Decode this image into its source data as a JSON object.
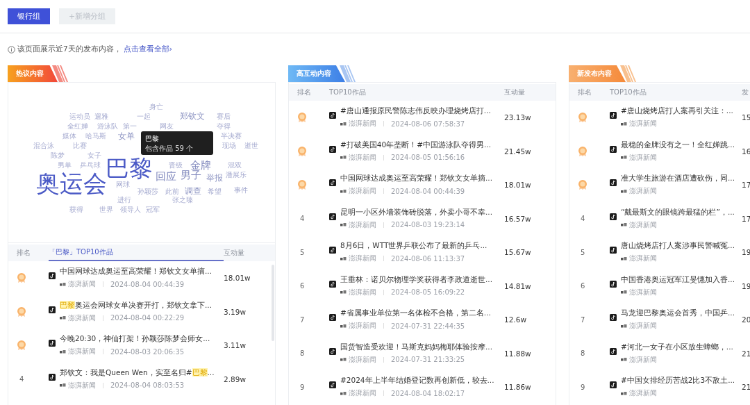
{
  "groups": [
    {
      "label": "银行组",
      "selected": true
    },
    {
      "label": "+新增分组",
      "selected": false
    }
  ],
  "notice": {
    "text": "该页面展示近7天的发布内容，",
    "link": "点击查看全部›"
  },
  "panels": [
    {
      "kind": "hot",
      "title": "热议内容",
      "word_cloud": {
        "words": [
          {
            "text": "身亡",
            "kind": "s"
          },
          {
            "text": "运动员",
            "kind": "s"
          },
          {
            "text": "遛雅",
            "kind": "s"
          },
          {
            "text": "一起",
            "kind": "s"
          },
          {
            "text": "郑钦文",
            "kind": "m"
          },
          {
            "text": "赛后",
            "kind": "s"
          },
          {
            "text": "全红婵",
            "kind": "s"
          },
          {
            "text": "游泳队",
            "kind": "s"
          },
          {
            "text": "第一",
            "kind": "s"
          },
          {
            "text": "网友",
            "kind": "s"
          },
          {
            "text": "夺得",
            "kind": "s"
          },
          {
            "text": "媒体",
            "kind": "s"
          },
          {
            "text": "哈马斯",
            "kind": "s"
          },
          {
            "text": "女单",
            "kind": "m"
          },
          {
            "text": "半决赛",
            "kind": "s"
          },
          {
            "text": "混合泳",
            "kind": "s"
          },
          {
            "text": "比赛",
            "kind": "s"
          },
          {
            "text": "现场",
            "kind": "s"
          },
          {
            "text": "逝世",
            "kind": "s"
          },
          {
            "text": "陈梦",
            "kind": "s"
          },
          {
            "text": "女子",
            "kind": "s"
          },
          {
            "text": "男单",
            "kind": "s"
          },
          {
            "text": "乒乓球",
            "kind": "s"
          },
          {
            "text": "巴黎",
            "kind": "xl"
          },
          {
            "text": "晋级",
            "kind": "s"
          },
          {
            "text": "金牌",
            "kind": "l"
          },
          {
            "text": "混双",
            "kind": "s"
          },
          {
            "text": "奥运会",
            "kind": "xl"
          },
          {
            "text": "网球",
            "kind": "s"
          },
          {
            "text": "回应",
            "kind": "l"
          },
          {
            "text": "男子",
            "kind": "l"
          },
          {
            "text": "举报",
            "kind": "m"
          },
          {
            "text": "潘展乐",
            "kind": "s"
          },
          {
            "text": "孙颖莎",
            "kind": "s"
          },
          {
            "text": "此前",
            "kind": "s"
          },
          {
            "text": "调查",
            "kind": "m"
          },
          {
            "text": "希望",
            "kind": "s"
          },
          {
            "text": "事件",
            "kind": "s"
          },
          {
            "text": "进行",
            "kind": "s"
          },
          {
            "text": "张之臻",
            "kind": "s"
          },
          {
            "text": "获得",
            "kind": "s"
          },
          {
            "text": "世界",
            "kind": "s"
          },
          {
            "text": "领导人",
            "kind": "s"
          },
          {
            "text": "冠军",
            "kind": "s"
          }
        ],
        "tooltip": {
          "title": "巴黎",
          "text": "包含作品 59 个"
        }
      },
      "columns": [
        "排名",
        "「巴黎」TOP10作品",
        "互动量"
      ],
      "works_tab_selected": true,
      "rows": [
        {
          "kind": "medal",
          "title": [
            {
              "text": "中国网球达成奥运至高荣耀！郑钦文女单摘...",
              "highlight": false
            }
          ],
          "source": "澎湃新闻",
          "time": "2024-08-04 00:44:39",
          "metric": "18.01w"
        },
        {
          "kind": "medal",
          "title": [
            {
              "text": "巴黎",
              "highlight": true
            },
            {
              "text": "奥运会网球女单决赛开打，郑钦文拿下...",
              "highlight": false
            }
          ],
          "source": "澎湃新闻",
          "time": "2024-08-04 00:22:29",
          "metric": "3.19w"
        },
        {
          "kind": "medal",
          "title": [
            {
              "text": "今晚20:30，神仙打架！孙颖莎陈梦会师女...",
              "highlight": false
            }
          ],
          "source": "澎湃新闻",
          "time": "2024-08-03 20:06:35",
          "metric": "3.11w"
        },
        {
          "kind": "number",
          "rank": "4",
          "title": [
            {
              "text": "郑钦文：我是Queen Wen，实至名归#",
              "highlight": false
            },
            {
              "text": "巴黎",
              "highlight": true
            },
            {
              "text": "...",
              "highlight": false
            }
          ],
          "source": "澎湃新闻",
          "time": "2024-08-04 08:03:53",
          "metric": "2.89w"
        }
      ]
    },
    {
      "kind": "interactive",
      "title": "高互动内容",
      "columns": [
        "排名",
        "TOP10作品",
        "互动量"
      ],
      "rows": [
        {
          "kind": "medal",
          "title": "#唐山通报原民警陈志伟反映办理烧烤店打...",
          "source": "澎湃新闻",
          "time": "2024-08-06 07:58:37",
          "metric": "23.13w"
        },
        {
          "kind": "medal",
          "title": "#打破美国40年垄断！#中国游泳队夺得男...",
          "source": "澎湃新闻",
          "time": "2024-08-05 01:56:16",
          "metric": "21.45w"
        },
        {
          "kind": "medal",
          "title": "中国网球达成奥运至高荣耀！郑钦文女单摘...",
          "source": "澎湃新闻",
          "time": "2024-08-04 00:44:39",
          "metric": "18.01w"
        },
        {
          "kind": "number",
          "rank": "4",
          "title": "昆明一小区外墙装饰砖脱落，外卖小哥不幸...",
          "source": "澎湃新闻",
          "time": "2024-08-03 19:23:14",
          "metric": "16.57w"
        },
        {
          "kind": "number",
          "rank": "5",
          "title": "8月6日，WTT世界乒联公布了最新的乒乓...",
          "source": "澎湃新闻",
          "time": "2024-08-06 11:13:37",
          "metric": "15.67w"
        },
        {
          "kind": "number",
          "rank": "6",
          "title": "王垂林：诺贝尔物理学奖获得者李政道逝世...",
          "source": "澎湃新闻",
          "time": "2024-08-05 16:09:22",
          "metric": "14.81w"
        },
        {
          "kind": "number",
          "rank": "7",
          "title": "#省属事业单位第一名体检不合格，第二名...",
          "source": "澎湃新闻",
          "time": "2024-07-31 22:44:35",
          "metric": "12.6w"
        },
        {
          "kind": "number",
          "rank": "8",
          "title": "国货智造受欢迎！马斯克妈妈梅耶体验按摩...",
          "source": "澎湃新闻",
          "time": "2024-07-31 21:33:25",
          "metric": "11.88w"
        },
        {
          "kind": "number",
          "rank": "9",
          "title": "#2024年上半年结婚登记数再创新低，较去...",
          "source": "澎湃新闻",
          "time": "2024-08-04 18:02:17",
          "metric": "11.86w"
        }
      ]
    },
    {
      "kind": "new",
      "title": "新发布内容",
      "columns": [
        "排名",
        "TOP10作品",
        "发"
      ],
      "rows": [
        {
          "kind": "medal",
          "title": "#唐山烧烤店打人案再引关注：...",
          "source": "澎湃新闻",
          "metric": "15"
        },
        {
          "kind": "medal",
          "title": "最稳的金牌没有之一！全红婵跳...",
          "source": "澎湃新闻",
          "metric": "16"
        },
        {
          "kind": "medal",
          "title": "准大学生旅游在酒店遭砍伤，同...",
          "source": "澎湃新闻",
          "metric": "17"
        },
        {
          "kind": "number",
          "rank": "4",
          "title": "“戴最斯文的眼镜跨最猛的栏”，...",
          "source": "澎湃新闻",
          "metric": "17"
        },
        {
          "kind": "number",
          "rank": "5",
          "title": "唐山烧烤店打人案涉事民警喊冤...",
          "source": "澎湃新闻",
          "metric": "19"
        },
        {
          "kind": "number",
          "rank": "6",
          "title": "中国香港奥运冠军江旻憓加入香...",
          "source": "澎湃新闻",
          "metric": "19"
        },
        {
          "kind": "number",
          "rank": "7",
          "title": "马龙迎巴黎奥运会首秀，中国乒...",
          "source": "澎湃新闻",
          "metric": "20"
        },
        {
          "kind": "number",
          "rank": "8",
          "title": "#河北一女子在小区放生蟑螂，...",
          "source": "澎湃新闻",
          "metric": "21"
        },
        {
          "kind": "number",
          "rank": "9",
          "title": "#中国女排经历苦战2比3不敌土...",
          "source": "澎湃新闻",
          "metric": "21"
        }
      ]
    }
  ]
}
